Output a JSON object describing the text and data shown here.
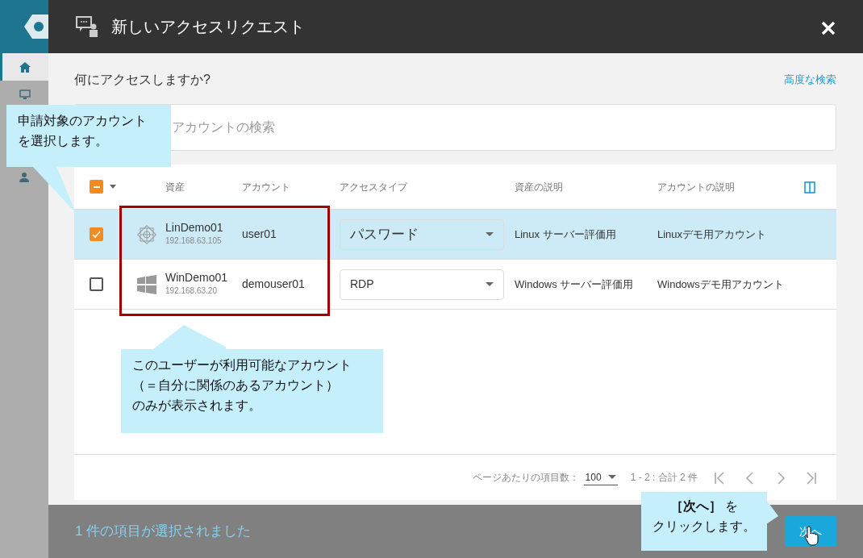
{
  "dialog": {
    "title": "新しいアクセスリクエスト",
    "question": "何にアクセスしますか?",
    "advanced_search": "高度な検索",
    "search": {
      "placeholder": "アカウントの検索"
    },
    "table": {
      "header_checkbox": {
        "indeterminate": true
      },
      "columns": [
        "資産",
        "アカウント",
        "アクセスタイプ",
        "資産の説明",
        "アカウントの説明"
      ],
      "rows": [
        {
          "selected": true,
          "kind": "linux",
          "asset": "LinDemo01",
          "address": "192.168.63.105",
          "account": "user01",
          "access_type": "パスワード",
          "asset_description": "Linux サーバー評価用",
          "account_description": "Linuxデモ用アカウント"
        },
        {
          "selected": false,
          "kind": "windows",
          "asset": "WinDemo01",
          "address": "192.168.63.20",
          "account": "demouser01",
          "access_type": "RDP",
          "asset_description": "Windows サーバー評価用",
          "account_description": "Windowsデモ用アカウント"
        }
      ]
    },
    "pagination": {
      "per_page_label": "ページあたりの項目数：",
      "per_page": "100",
      "range": "1 - 2 : 合計 2 件"
    },
    "footer": {
      "status": "1 件の項目が選択されました",
      "next_button": "次へ"
    }
  },
  "callouts": [
    {
      "lines": [
        "申請対象のアカウント",
        "を選択します。"
      ]
    },
    {
      "lines": [
        "このユーザーが利用可能なアカウント",
        "（＝自分に関係のあるアカウント）",
        "のみが表示されます。"
      ]
    },
    {
      "lines": [
        "**［次へ］** を",
        "クリックします。"
      ]
    }
  ]
}
